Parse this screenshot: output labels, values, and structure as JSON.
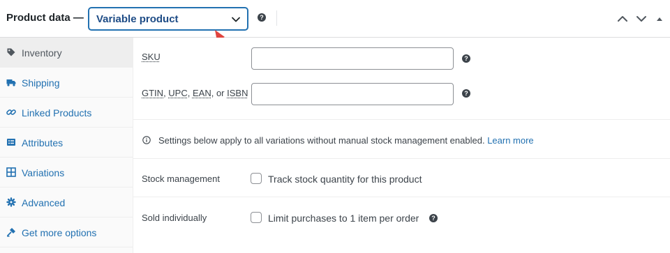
{
  "header": {
    "title": "Product data —",
    "product_type": "Variable product"
  },
  "tabs": [
    {
      "label": "Inventory",
      "icon": "tag-icon",
      "active": true
    },
    {
      "label": "Shipping",
      "icon": "truck-icon",
      "active": false
    },
    {
      "label": "Linked Products",
      "icon": "link-icon",
      "active": false
    },
    {
      "label": "Attributes",
      "icon": "list-icon",
      "active": false
    },
    {
      "label": "Variations",
      "icon": "grid-icon",
      "active": false
    },
    {
      "label": "Advanced",
      "icon": "gear-icon",
      "active": false
    },
    {
      "label": "Get more options",
      "icon": "plug-icon",
      "active": false
    }
  ],
  "inventory": {
    "sku_label": "SKU",
    "sku_value": "",
    "gtin_label": {
      "abbr1": "GTIN",
      "sep1": ", ",
      "abbr2": "UPC",
      "sep2": ", ",
      "abbr3": "EAN",
      "sep3": ", or ",
      "abbr4": "ISBN"
    },
    "gtin_value": "",
    "notice_text": "Settings below apply to all variations without manual stock management enabled.",
    "notice_link": "Learn more",
    "stock_management_label": "Stock management",
    "stock_checkbox_label": "Track stock quantity for this product",
    "stock_checked": false,
    "sold_individually_label": "Sold individually",
    "sold_checkbox_label": "Limit purchases to 1 item per order",
    "sold_checked": false
  },
  "colors": {
    "link": "#2271b1",
    "select_border": "#2271b1",
    "annotation_arrow": "#e0443e"
  }
}
